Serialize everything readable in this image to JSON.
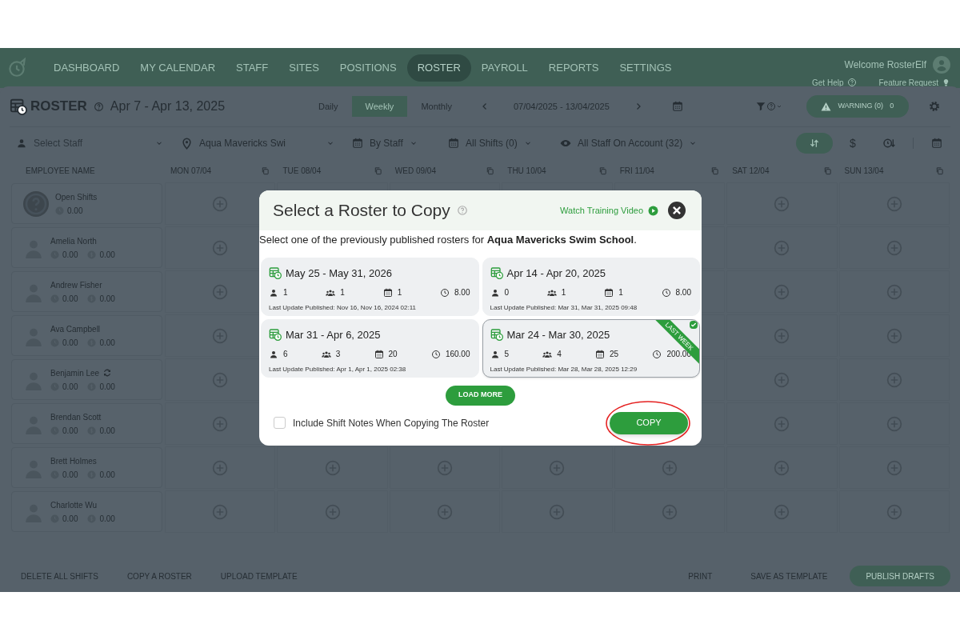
{
  "nav": {
    "items": [
      {
        "label": "DASHBOARD",
        "selected": false
      },
      {
        "label": "MY CALENDAR",
        "selected": false
      },
      {
        "label": "STAFF",
        "selected": false
      },
      {
        "label": "SITES",
        "selected": false
      },
      {
        "label": "POSITIONS",
        "selected": false
      },
      {
        "label": "ROSTER",
        "selected": true
      },
      {
        "label": "PAYROLL",
        "selected": false
      },
      {
        "label": "REPORTS",
        "selected": false
      },
      {
        "label": "SETTINGS",
        "selected": false
      }
    ],
    "welcome": "Welcome RosterElf",
    "help": "Get Help",
    "feature": "Feature Request"
  },
  "toolbar": {
    "title": "ROSTER",
    "range": "Apr 7 - Apr 13, 2025",
    "views": [
      {
        "label": "Daily",
        "selected": false
      },
      {
        "label": "Weekly",
        "selected": true
      },
      {
        "label": "Monthly",
        "selected": false
      }
    ],
    "dates": "07/04/2025 - 13/04/2025",
    "warning": "WARNING (0)",
    "warning_count": "0"
  },
  "filters": {
    "staff_placeholder": "Select Staff",
    "location": "Aqua Mavericks Swi",
    "group": "By Staff",
    "shifts": "All Shifts (0)",
    "visibility": "All Staff On Account (32)",
    "currency": "$"
  },
  "table": {
    "columns": [
      "EMPLOYEE NAME",
      "MON 07/04",
      "TUE 08/04",
      "WED 09/04",
      "THU 10/04",
      "FRI 11/04",
      "SAT 12/04",
      "SUN 13/04"
    ],
    "rows": [
      {
        "kind": "open",
        "name": "Open Shifts",
        "hours": "0.00"
      },
      {
        "kind": "staff",
        "name": "Amelia North",
        "hours": "0.00",
        "cost": "0.00",
        "swap": false
      },
      {
        "kind": "staff",
        "name": "Andrew Fisher",
        "hours": "0.00",
        "cost": "0.00",
        "swap": false
      },
      {
        "kind": "staff",
        "name": "Ava Campbell",
        "hours": "0.00",
        "cost": "0.00",
        "swap": false
      },
      {
        "kind": "staff",
        "name": "Benjamin Lee",
        "hours": "0.00",
        "cost": "0.00",
        "swap": true
      },
      {
        "kind": "staff",
        "name": "Brendan Scott",
        "hours": "0.00",
        "cost": "0.00",
        "swap": false
      },
      {
        "kind": "staff",
        "name": "Brett Holmes",
        "hours": "0.00",
        "cost": "0.00",
        "swap": false
      },
      {
        "kind": "staff",
        "name": "Charlotte Wu",
        "hours": "0.00",
        "cost": "0.00",
        "swap": false
      }
    ]
  },
  "footer": {
    "left": [
      "DELETE ALL SHIFTS",
      "COPY A ROSTER",
      "UPLOAD TEMPLATE"
    ],
    "right": [
      "PRINT",
      "SAVE AS TEMPLATE"
    ],
    "primary": "PUBLISH DRAFTS"
  },
  "modal": {
    "title": "Select a Roster to Copy",
    "video": "Watch Training Video",
    "intro": "Select one of the previously published rosters for **Aqua Mavericks Swim School**.",
    "rosters": [
      {
        "range": "May 25 - May 31, 2026",
        "staff": "1",
        "positions": "1",
        "shifts": "1",
        "hours": "8.00",
        "updated": "Last Update Published: Nov 16, Nov 16, 2024 02:11",
        "selected": false
      },
      {
        "range": "Apr 14 - Apr 20, 2025",
        "staff": "0",
        "positions": "1",
        "shifts": "1",
        "hours": "8.00",
        "updated": "Last Update Published: Mar 31, Mar 31, 2025 09:48",
        "selected": false
      },
      {
        "range": "Mar 31 - Apr 6, 2025",
        "staff": "6",
        "positions": "3",
        "shifts": "20",
        "hours": "160.00",
        "updated": "Last Update Published: Apr 1, Apr 1, 2025 02:38",
        "selected": false
      },
      {
        "range": "Mar 24 - Mar 30, 2025",
        "staff": "5",
        "positions": "4",
        "shifts": "25",
        "hours": "200.00",
        "updated": "Last Update Published: Mar 28, Mar 28, 2025 12:29",
        "selected": true,
        "badge": "LAST WEEK"
      }
    ],
    "load_more": "LOAD MORE",
    "include_notes": {
      "label": "Include Shift Notes When Copying The Roster",
      "checked": false
    },
    "copy": "COPY"
  }
}
